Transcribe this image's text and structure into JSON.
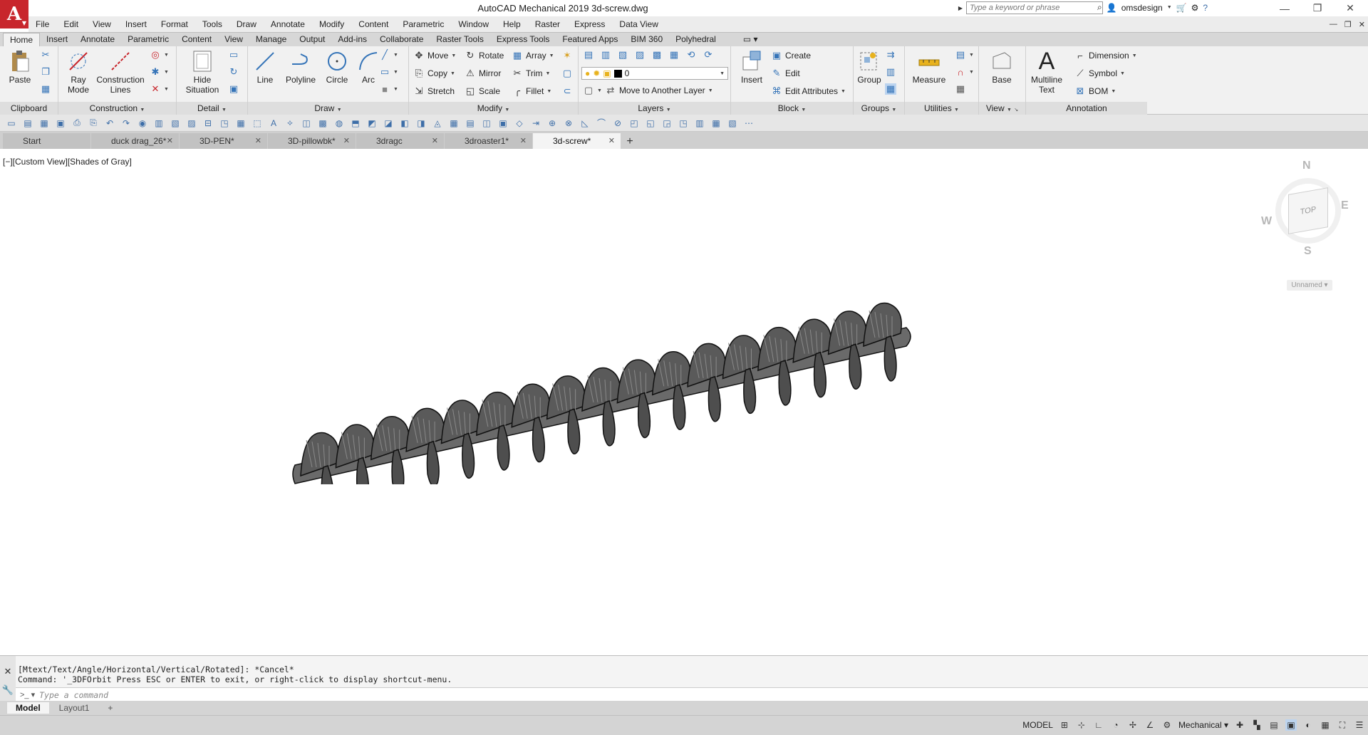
{
  "app": {
    "logo": "A",
    "title": "AutoCAD Mechanical 2019    3d-screw.dwg"
  },
  "search": {
    "placeholder": "Type a keyword or phrase"
  },
  "user": {
    "name": "omsdesign"
  },
  "menu": [
    "File",
    "Edit",
    "View",
    "Insert",
    "Format",
    "Tools",
    "Draw",
    "Annotate",
    "Modify",
    "Content",
    "Parametric",
    "Window",
    "Help",
    "Raster",
    "Express",
    "Data View"
  ],
  "ribbon_tabs": [
    "Home",
    "Insert",
    "Annotate",
    "Parametric",
    "Content",
    "View",
    "Manage",
    "Output",
    "Add-ins",
    "Collaborate",
    "Raster Tools",
    "Express Tools",
    "Featured Apps",
    "BIM 360",
    "Polyhedral"
  ],
  "ribbon": {
    "clipboard": {
      "title": "Clipboard",
      "paste": "Paste"
    },
    "construction": {
      "title": "Construction",
      "ray_mode": "Ray\nMode",
      "construction_lines": "Construction\nLines"
    },
    "detail": {
      "title": "Detail",
      "hide_situation": "Hide\nSituation"
    },
    "draw": {
      "title": "Draw",
      "line": "Line",
      "polyline": "Polyline",
      "circle": "Circle",
      "arc": "Arc"
    },
    "modify": {
      "title": "Modify",
      "move": "Move",
      "rotate": "Rotate",
      "array": "Array",
      "copy": "Copy",
      "mirror": "Mirror",
      "trim": "Trim",
      "stretch": "Stretch",
      "scale": "Scale",
      "fillet": "Fillet"
    },
    "layers": {
      "title": "Layers",
      "current_layer": "0",
      "move_to_layer": "Move to Another Layer"
    },
    "block": {
      "title": "Block",
      "insert": "Insert",
      "create": "Create",
      "edit": "Edit",
      "edit_attributes": "Edit Attributes"
    },
    "groups": {
      "title": "Groups",
      "group": "Group"
    },
    "utilities": {
      "title": "Utilities",
      "measure": "Measure"
    },
    "view": {
      "title": "View",
      "base": "Base"
    },
    "annotation": {
      "title": "Annotation",
      "multiline_text": "Multiline\nText",
      "dimension": "Dimension",
      "symbol": "Symbol",
      "bom": "BOM"
    }
  },
  "file_tabs": [
    {
      "label": "Start",
      "active": false,
      "closable": false
    },
    {
      "label": "duck drag_26*",
      "active": false,
      "closable": true
    },
    {
      "label": "3D-PEN*",
      "active": false,
      "closable": true
    },
    {
      "label": "3D-pillowbk*",
      "active": false,
      "closable": true
    },
    {
      "label": "3dragc",
      "active": false,
      "closable": true
    },
    {
      "label": "3droaster1*",
      "active": false,
      "closable": true
    },
    {
      "label": "3d-screw*",
      "active": true,
      "closable": true
    }
  ],
  "viewport": {
    "label": "[−][Custom View][Shades of Gray]"
  },
  "viewcube": {
    "n": "N",
    "s": "S",
    "e": "E",
    "w": "W",
    "face": "TOP",
    "ucs": "Unnamed"
  },
  "command": {
    "history": [
      "[Mtext/Text/Angle/Horizontal/Vertical/Rotated]: *Cancel*",
      "Command: '_3DFOrbit Press ESC or ENTER to exit, or right-click to display shortcut-menu."
    ],
    "placeholder": "Type a command"
  },
  "layout_tabs": [
    {
      "label": "Model",
      "active": true
    },
    {
      "label": "Layout1",
      "active": false
    }
  ],
  "status": {
    "mode": "MODEL",
    "workspace": "Mechanical"
  },
  "colors": {
    "accent": "#c8262c",
    "ribbon_bg": "#f1f1f1",
    "screw": "#5a5a5a"
  }
}
